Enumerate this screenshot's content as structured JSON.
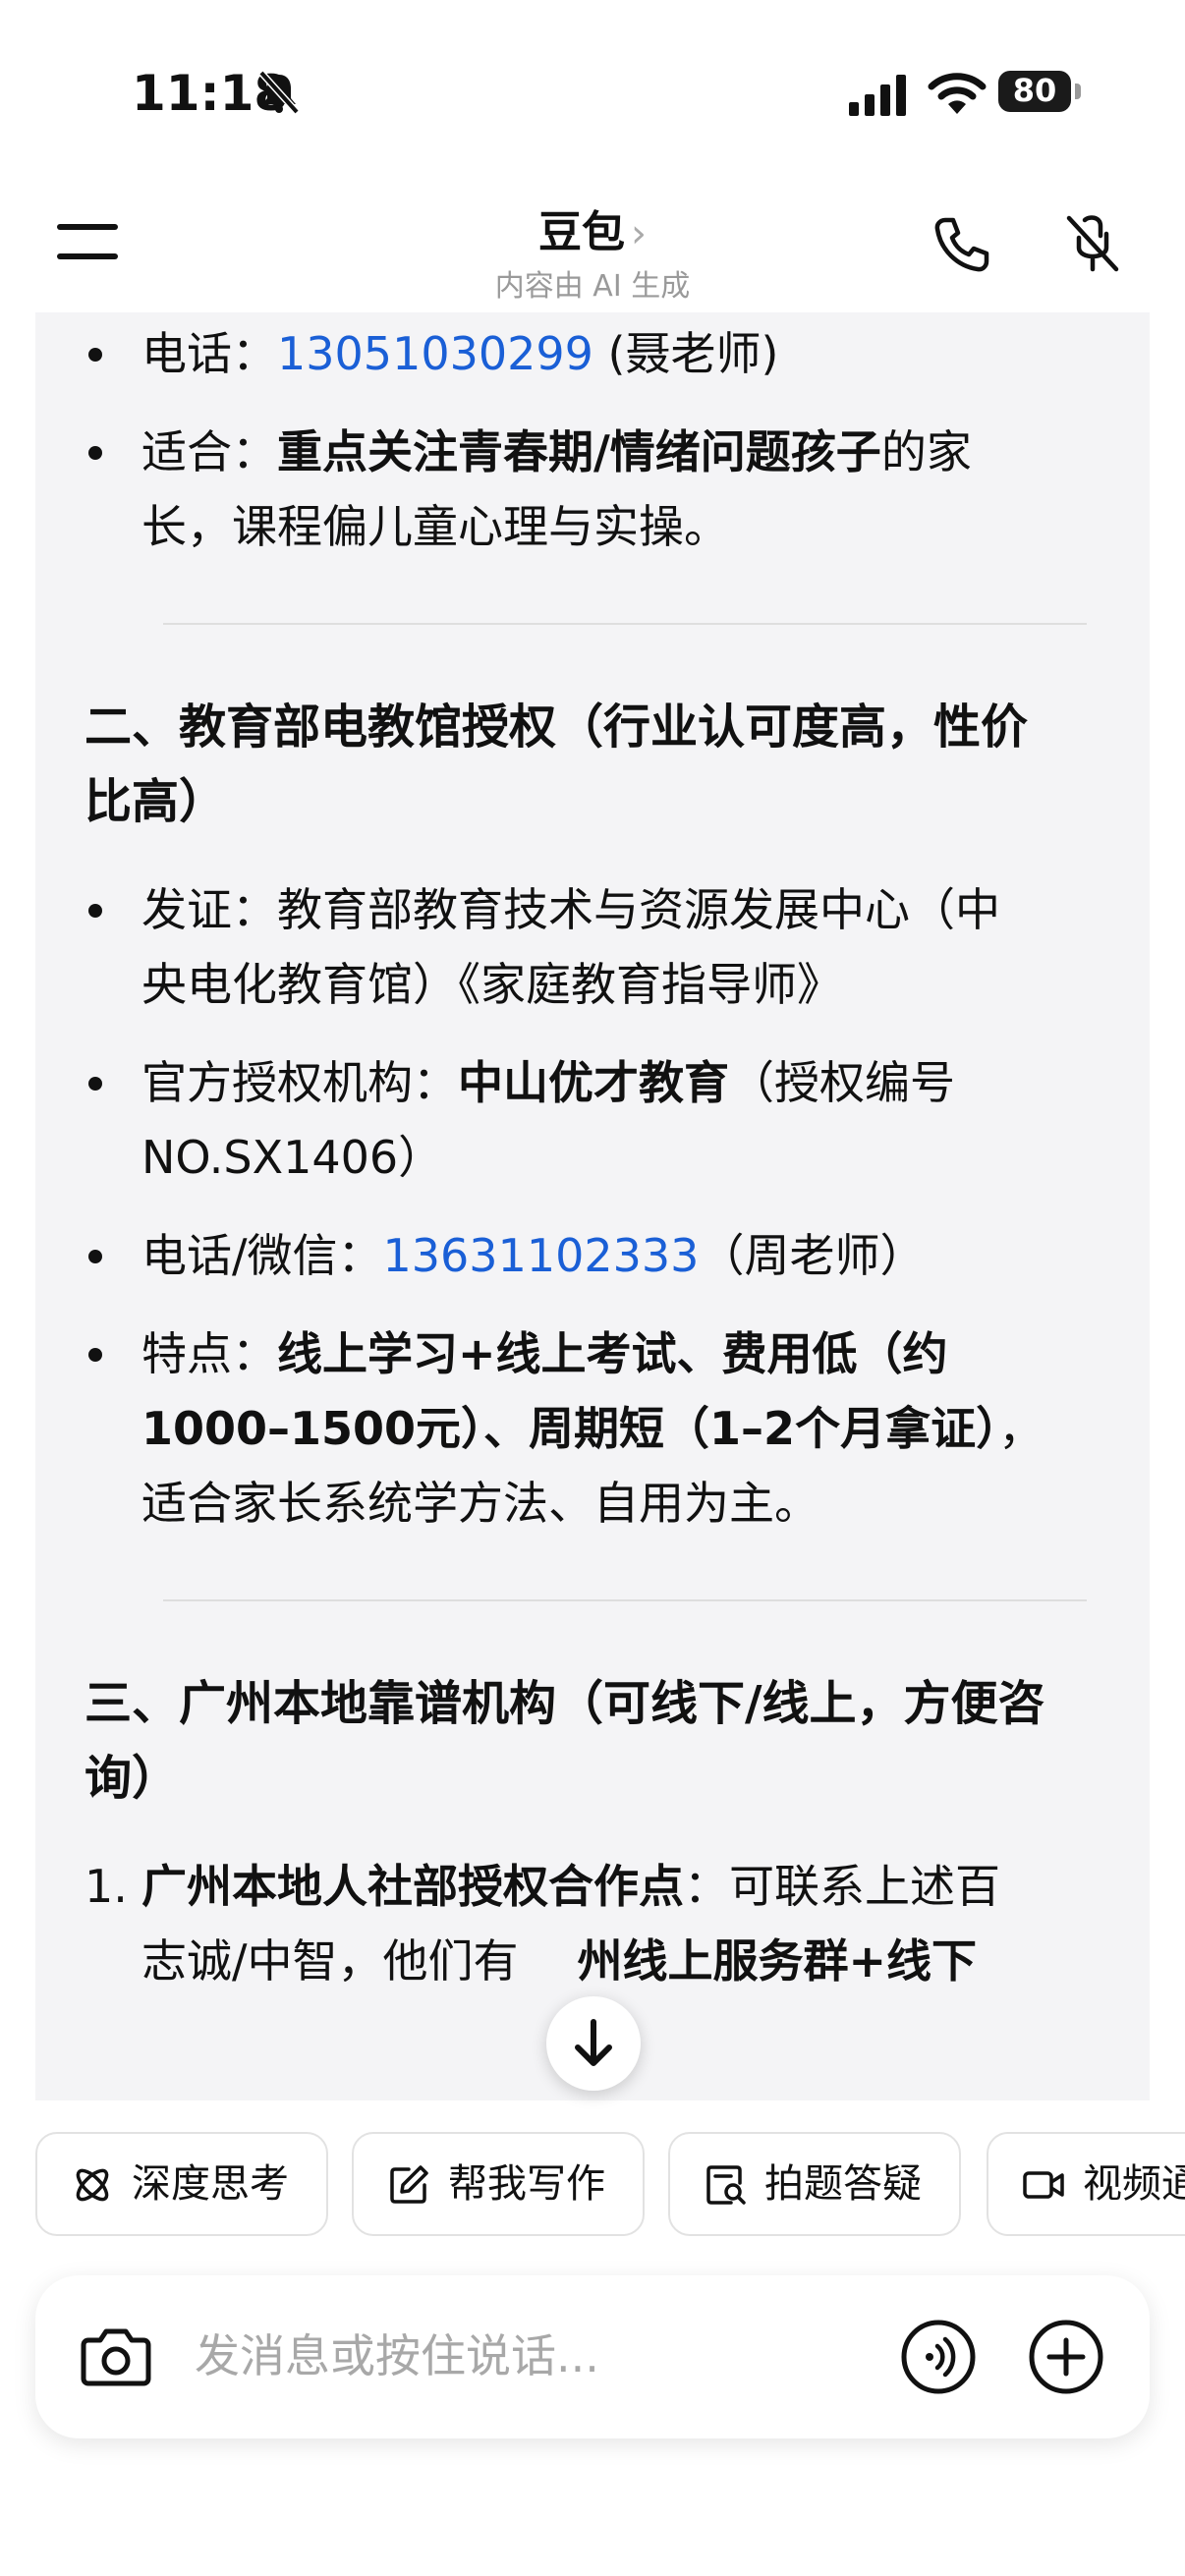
{
  "status_bar": {
    "time": "11:18",
    "battery": "80"
  },
  "header": {
    "title": "豆包",
    "subtitle": "内容由 AI 生成"
  },
  "message": {
    "top_phone": {
      "label": "电话：",
      "number": "13051030299",
      "suffix": " (聂老师)"
    },
    "top_fit": {
      "label": "适合：",
      "bold": "重点关注青春期/情绪问题孩子",
      "rest1": "的家",
      "line2": "长，课程偏儿童心理与实操。"
    },
    "section2": {
      "heading_line1": "二、教育部电教馆授权（行业认可度高，性价",
      "heading_line2": "比高）",
      "cert_line1": "发证：教育部教育技术与资源发展中心（中",
      "cert_line2": "央电化教育馆）《家庭教育指导师》",
      "org_label": "官方授权机构：",
      "org_name": "中山优才教育",
      "org_suffix": "（授权编号",
      "org_line2": "NO.SX1406）",
      "contact_label": "电话/微信：",
      "contact_number": "13631102333",
      "contact_suffix": "（周老师）",
      "feature_label": "特点：",
      "feature_bold1": "线上学习+线上考试、费用低（约",
      "feature_bold2": "1000–1500元）、周期短（1–2个月拿证）",
      "feature_comma": "，",
      "feature_line3": "适合家长系统学方法、自用为主。"
    },
    "section3": {
      "heading_line1": "三、广州本地靠谱机构（可线下/线上，方便咨",
      "heading_line2": "询）",
      "item1_num": "1.",
      "item1_bold": "广州本地人社部授权合作点",
      "item1_rest": "：可联系上述百",
      "item1_line2a": "志诚/中智，他们有",
      "item1_line2b": "州线上服务群+线下"
    }
  },
  "chips": [
    {
      "label": "深度思考",
      "icon": "atom-icon"
    },
    {
      "label": "帮我写作",
      "icon": "edit-icon"
    },
    {
      "label": "拍题答疑",
      "icon": "scan-doc-icon"
    },
    {
      "label": "视频通",
      "icon": "video-icon"
    }
  ],
  "input": {
    "placeholder": "发消息或按住说话..."
  }
}
